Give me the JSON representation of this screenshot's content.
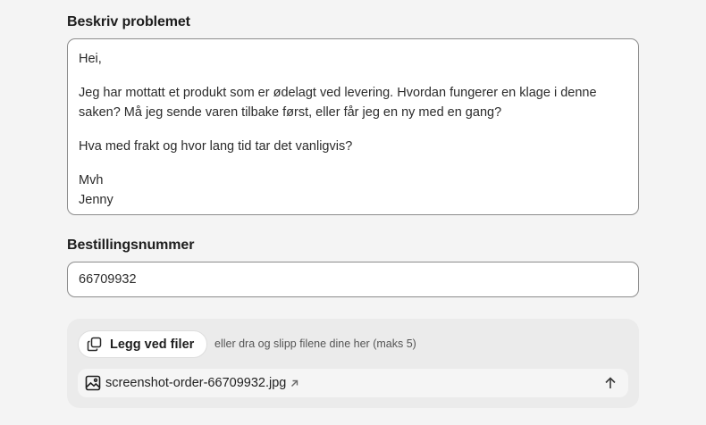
{
  "description": {
    "label": "Beskriv problemet",
    "lines": [
      "Hei,",
      "Jeg har mottatt et produkt som er ødelagt ved levering. Hvordan fungerer en klage i denne saken? Må jeg sende varen tilbake først, eller får jeg en ny med en gang?",
      "Hva med frakt og hvor lang tid tar det vanligvis?",
      "Mvh",
      "Jenny"
    ]
  },
  "order": {
    "label": "Bestillingsnummer",
    "value": "66709932"
  },
  "attachments": {
    "button_label": "Legg ved filer",
    "hint": "eller dra og slipp filene dine her (maks 5)",
    "files": [
      {
        "name": "screenshot-order-66709932.jpg"
      }
    ]
  },
  "icons": {
    "attach": "copy-icon",
    "file": "image-icon",
    "open": "arrow-up-right-icon",
    "upload": "arrow-up-icon"
  }
}
